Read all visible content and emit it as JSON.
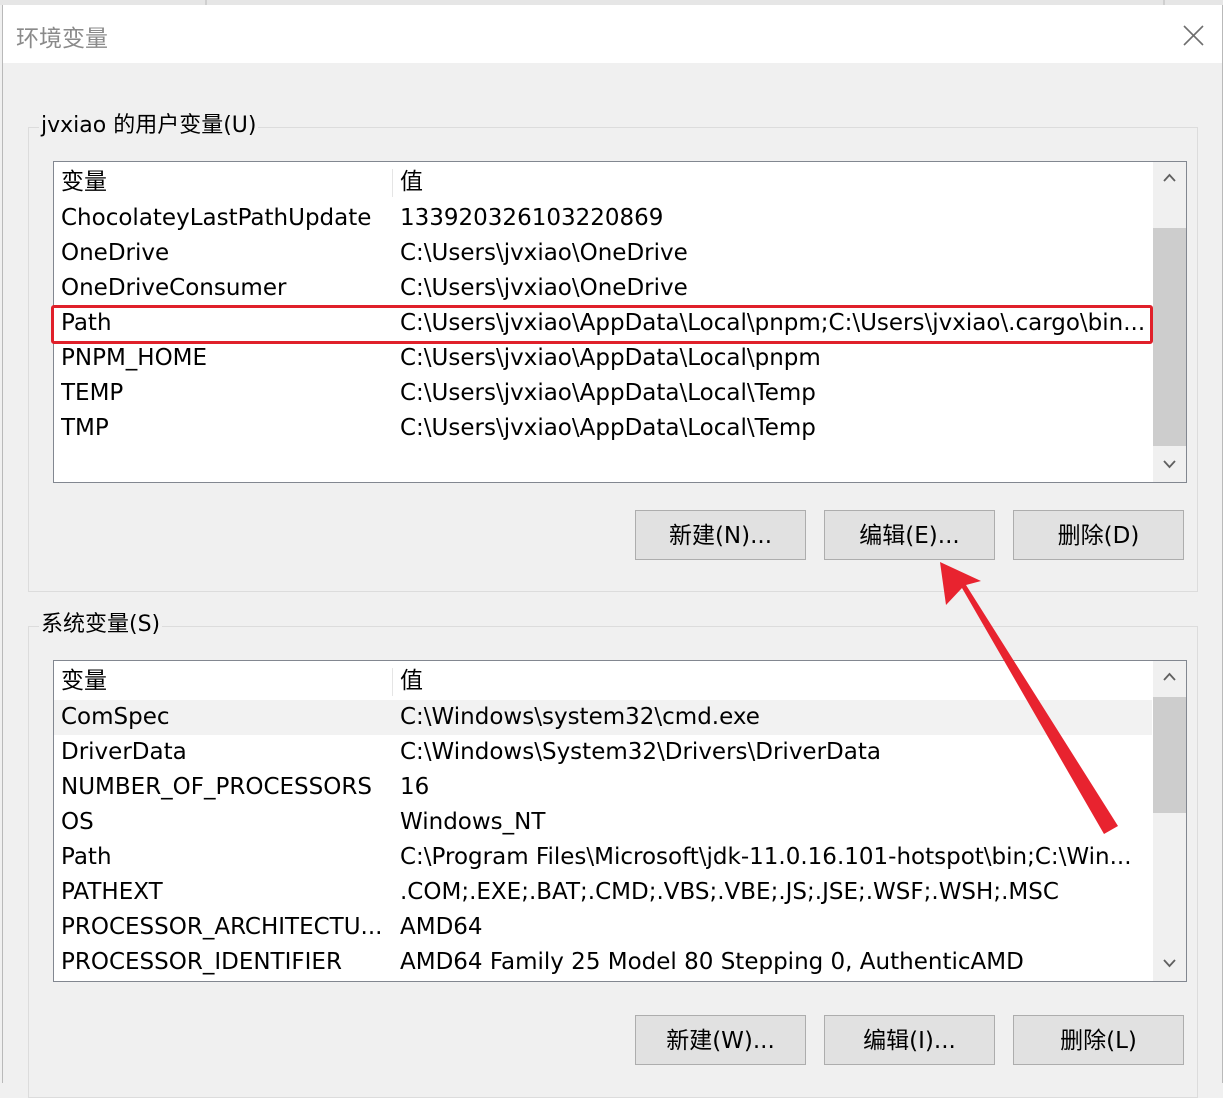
{
  "dialog": {
    "title": "环境变量"
  },
  "user_vars": {
    "group_label": "jvxiao 的用户变量(U)",
    "columns": {
      "name": "变量",
      "value": "值"
    },
    "rows": [
      {
        "name": "ChocolateyLastPathUpdate",
        "value": "133920326103220869"
      },
      {
        "name": "OneDrive",
        "value": "C:\\Users\\jvxiao\\OneDrive"
      },
      {
        "name": "OneDriveConsumer",
        "value": "C:\\Users\\jvxiao\\OneDrive"
      },
      {
        "name": "Path",
        "value": "C:\\Users\\jvxiao\\AppData\\Local\\pnpm;C:\\Users\\jvxiao\\.cargo\\bin..."
      },
      {
        "name": "PNPM_HOME",
        "value": "C:\\Users\\jvxiao\\AppData\\Local\\pnpm"
      },
      {
        "name": "TEMP",
        "value": "C:\\Users\\jvxiao\\AppData\\Local\\Temp"
      },
      {
        "name": "TMP",
        "value": "C:\\Users\\jvxiao\\AppData\\Local\\Temp"
      }
    ],
    "buttons": {
      "new": "新建(N)...",
      "edit": "编辑(E)...",
      "delete": "删除(D)"
    }
  },
  "system_vars": {
    "group_label": "系统变量(S)",
    "columns": {
      "name": "变量",
      "value": "值"
    },
    "rows": [
      {
        "name": "ComSpec",
        "value": "C:\\Windows\\system32\\cmd.exe"
      },
      {
        "name": "DriverData",
        "value": "C:\\Windows\\System32\\Drivers\\DriverData"
      },
      {
        "name": "NUMBER_OF_PROCESSORS",
        "value": "16"
      },
      {
        "name": "OS",
        "value": "Windows_NT"
      },
      {
        "name": "Path",
        "value": "C:\\Program Files\\Microsoft\\jdk-11.0.16.101-hotspot\\bin;C:\\Win..."
      },
      {
        "name": "PATHEXT",
        "value": ".COM;.EXE;.BAT;.CMD;.VBS;.VBE;.JS;.JSE;.WSF;.WSH;.MSC"
      },
      {
        "name": "PROCESSOR_ARCHITECTU...",
        "value": "AMD64"
      },
      {
        "name": "PROCESSOR_IDENTIFIER",
        "value": "AMD64 Family 25 Model 80 Stepping 0, AuthenticAMD"
      }
    ],
    "buttons": {
      "new": "新建(W)...",
      "edit": "编辑(I)...",
      "delete": "删除(L)"
    }
  },
  "icons": {
    "close": "close-icon",
    "scroll_up": "chevron-up-icon",
    "scroll_down": "chevron-down-icon",
    "annotation": "red-arrow-icon"
  },
  "colors": {
    "highlight": "#e0202a",
    "annotation_arrow": "#e8232f"
  }
}
